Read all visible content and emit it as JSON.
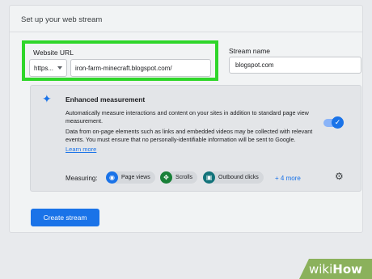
{
  "card": {
    "title": "Set up your web stream"
  },
  "website_url": {
    "label": "Website URL",
    "protocol": "https...",
    "value": "iron-farm-minecraft.blogspot.com/"
  },
  "stream_name": {
    "label": "Stream name",
    "value": "blogspot.com"
  },
  "enhanced": {
    "title": "Enhanced measurement",
    "desc1": "Automatically measure interactions and content on your sites in addition to standard page view measurement.",
    "desc2": "Data from on-page elements such as links and embedded videos may be collected with relevant events. You must ensure that no personally-identifiable information will be sent to Google.",
    "learn_more": "Learn more",
    "toggle_checked": true,
    "measuring_label": "Measuring:",
    "chips": [
      {
        "label": "Page views",
        "icon": "eye-icon",
        "color": "#1a73e8"
      },
      {
        "label": "Scrolls",
        "icon": "move-icon",
        "color": "#188038"
      },
      {
        "label": "Outbound clicks",
        "icon": "lock-icon",
        "color": "#12737a"
      }
    ],
    "more": "+ 4 more"
  },
  "create_button": "Create stream",
  "watermark": {
    "wiki": "wiki",
    "how": "How"
  },
  "colors": {
    "accent": "#1a73e8",
    "highlight": "#2fd62a",
    "watermark": "#8bb15c"
  }
}
